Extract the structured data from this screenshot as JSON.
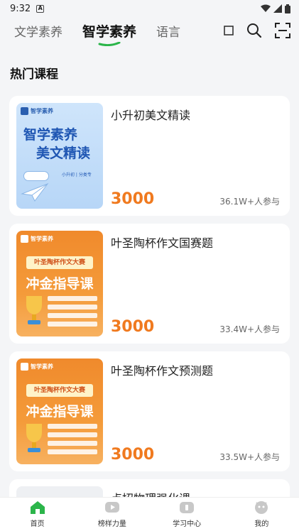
{
  "status": {
    "time": "9:32",
    "notif_letter": "A"
  },
  "nav": {
    "tabs": [
      {
        "label": "文学素养"
      },
      {
        "label": "智学素养"
      },
      {
        "label": "语言"
      }
    ],
    "active_index": 1,
    "accent": "#2bb54a"
  },
  "section": {
    "title": "热门课程"
  },
  "courses": [
    {
      "title": "小升初美文精读",
      "price": "3000",
      "participants": "36.1W+人参与",
      "thumb": {
        "theme": "blue",
        "brand": "智学素养",
        "line1": "智学素养",
        "line2": "美文精读",
        "mini": "小升初 | 分类专"
      }
    },
    {
      "title": "叶圣陶杯作文国赛题",
      "price": "3000",
      "participants": "33.4W+人参与",
      "thumb": {
        "theme": "orange",
        "brand": "智学素养",
        "ribbon": "叶圣陶杯作文大赛",
        "slogan": "冲金指导课"
      }
    },
    {
      "title": "叶圣陶杯作文预测题",
      "price": "3000",
      "participants": "33.5W+人参与",
      "thumb": {
        "theme": "orange",
        "brand": "智学素养",
        "ribbon": "叶圣陶杯作文大赛",
        "slogan": "冲金指导课"
      }
    },
    {
      "title": "点招物理强化课"
    }
  ],
  "tabbar": {
    "items": [
      {
        "label": "首页",
        "icon": "home-icon"
      },
      {
        "label": "榜样力量",
        "icon": "video-icon"
      },
      {
        "label": "学习中心",
        "icon": "study-icon"
      },
      {
        "label": "我的",
        "icon": "profile-icon"
      }
    ],
    "active_color": "#2bb54a",
    "inactive_color": "#c8c8c8"
  }
}
